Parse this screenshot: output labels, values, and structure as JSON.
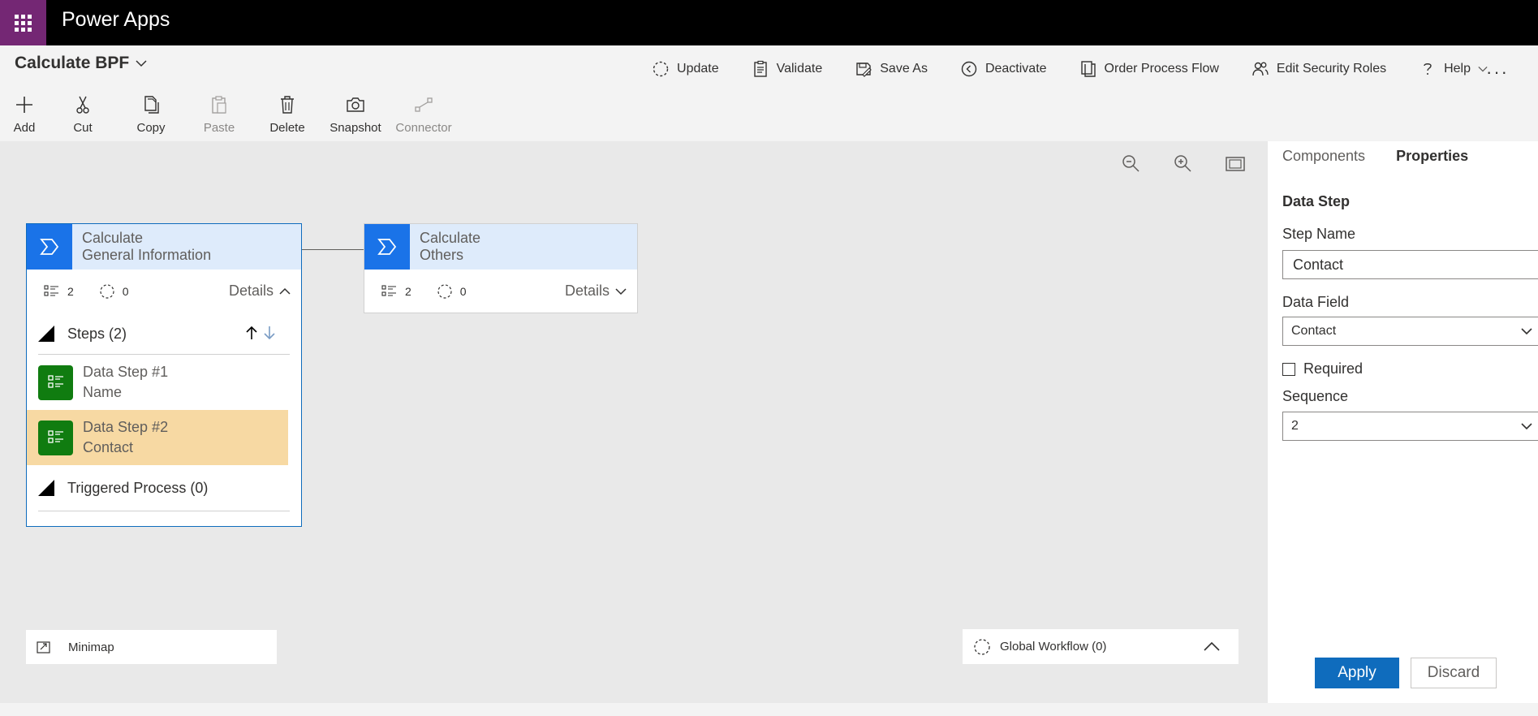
{
  "app": {
    "name": "Power Apps"
  },
  "process": {
    "title": "Calculate BPF"
  },
  "top_commands": [
    {
      "label": "Update",
      "icon": "dashed-circle-icon"
    },
    {
      "label": "Validate",
      "icon": "clipboard-check-icon"
    },
    {
      "label": "Save As",
      "icon": "save-as-icon"
    },
    {
      "label": "Deactivate",
      "icon": "deactivate-icon"
    },
    {
      "label": "Order Process Flow",
      "icon": "order-icon"
    },
    {
      "label": "Edit Security Roles",
      "icon": "security-roles-icon"
    },
    {
      "label": "Help",
      "icon": "help-icon"
    }
  ],
  "more_label": "···",
  "tools": [
    {
      "label": "Add",
      "disabled": false
    },
    {
      "label": "Cut",
      "disabled": false
    },
    {
      "label": "Copy",
      "disabled": false
    },
    {
      "label": "Paste",
      "disabled": true
    },
    {
      "label": "Delete",
      "disabled": false
    },
    {
      "label": "Snapshot",
      "disabled": false
    },
    {
      "label": "Connector",
      "disabled": true
    }
  ],
  "stages": [
    {
      "title_line1": "Calculate",
      "title_line2": "General Information",
      "steps_count": "2",
      "workflows_count": "0",
      "details_label": "Details",
      "steps_section_label": "Steps (2)",
      "steps": [
        {
          "title": "Data Step #1",
          "subtitle": "Name"
        },
        {
          "title": "Data Step #2",
          "subtitle": "Contact"
        }
      ],
      "triggered_label": "Triggered Process (0)"
    },
    {
      "title_line1": "Calculate",
      "title_line2": "Others",
      "steps_count": "2",
      "workflows_count": "0",
      "details_label": "Details"
    }
  ],
  "minimap_label": "Minimap",
  "global_workflow_label": "Global Workflow (0)",
  "panel": {
    "tabs": [
      "Components",
      "Properties"
    ],
    "active_tab": "Properties",
    "heading": "Data Step",
    "step_name_label": "Step Name",
    "step_name_value": "Contact",
    "data_field_label": "Data Field",
    "data_field_value": "Contact",
    "required_label": "Required",
    "required_checked": false,
    "sequence_label": "Sequence",
    "sequence_value": "2",
    "apply_label": "Apply",
    "discard_label": "Discard"
  },
  "colors": {
    "brand_purple": "#742774",
    "stage_blue": "#1a73e8",
    "step_green": "#107c10",
    "selection_highlight": "#f7d9a3",
    "primary_button": "#0f6cbd"
  }
}
